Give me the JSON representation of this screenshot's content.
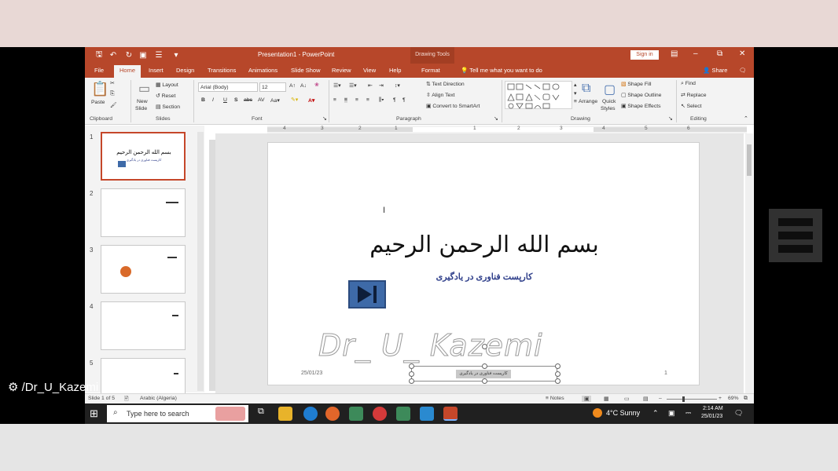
{
  "app": {
    "title": "Presentation1 - PowerPoint",
    "contextual_tab_group": "Drawing Tools",
    "sign_in": "Sign in"
  },
  "tabs": [
    {
      "label": "File"
    },
    {
      "label": "Home"
    },
    {
      "label": "Insert"
    },
    {
      "label": "Design"
    },
    {
      "label": "Transitions"
    },
    {
      "label": "Animations"
    },
    {
      "label": "Slide Show"
    },
    {
      "label": "Review"
    },
    {
      "label": "View"
    },
    {
      "label": "Help"
    },
    {
      "label": "Format"
    }
  ],
  "tell_me": "Tell me what you want to do",
  "share": "Share",
  "ribbon": {
    "clipboard": {
      "label": "Clipboard",
      "paste": "Paste"
    },
    "slides": {
      "label": "Slides",
      "new_slide": "New",
      "new_slide2": "Slide",
      "layout": "Layout",
      "reset": "Reset",
      "section": "Section"
    },
    "font": {
      "label": "Font",
      "font_name": "Arial (Body)",
      "font_size": "12"
    },
    "paragraph": {
      "label": "Paragraph",
      "text_direction": "Text Direction",
      "align_text": "Align Text",
      "convert_smartart": "Convert to SmartArt"
    },
    "drawing": {
      "label": "Drawing",
      "arrange": "Arrange",
      "quick_styles": "Quick",
      "quick_styles2": "Styles",
      "shape_fill": "Shape Fill",
      "shape_outline": "Shape Outline",
      "shape_effects": "Shape Effects"
    },
    "editing": {
      "label": "Editing",
      "find": "Find",
      "replace": "Replace",
      "select": "Select"
    }
  },
  "ruler": [
    "4",
    "3",
    "2",
    "1",
    "1",
    "2",
    "3",
    "4",
    "5",
    "6"
  ],
  "thumbnails": [
    {
      "num": "1",
      "title": "بسم الله الرحمن الرحیم",
      "subtitle": "کارپست فناوری در یادگیری"
    },
    {
      "num": "2"
    },
    {
      "num": "3"
    },
    {
      "num": "4"
    },
    {
      "num": "5"
    }
  ],
  "slide": {
    "title": "بسم الله الرحمن الرحیم",
    "subtitle": "کارپست فناوری در یادگیری",
    "watermark": "Dr_ U_ Kazemi",
    "date": "25/01/23",
    "footer": "کارپست فناوری در یادگیری",
    "number": "1"
  },
  "status": {
    "slide_of": "Slide 1 of 5",
    "language": "Arabic (Algeria)",
    "notes": "Notes",
    "zoom": "69%"
  },
  "taskbar": {
    "search_placeholder": "Type here to search",
    "weather": "4°C  Sunny",
    "time": "2:14 AM",
    "date": "25/01/23"
  },
  "overlay": {
    "handle": "/Dr_U_Kazemi"
  },
  "colors": {
    "accent": "#b7472a",
    "taskbar": "#202020",
    "subtitle": "#2e3e8a",
    "media_button": "#3e6aa8"
  }
}
